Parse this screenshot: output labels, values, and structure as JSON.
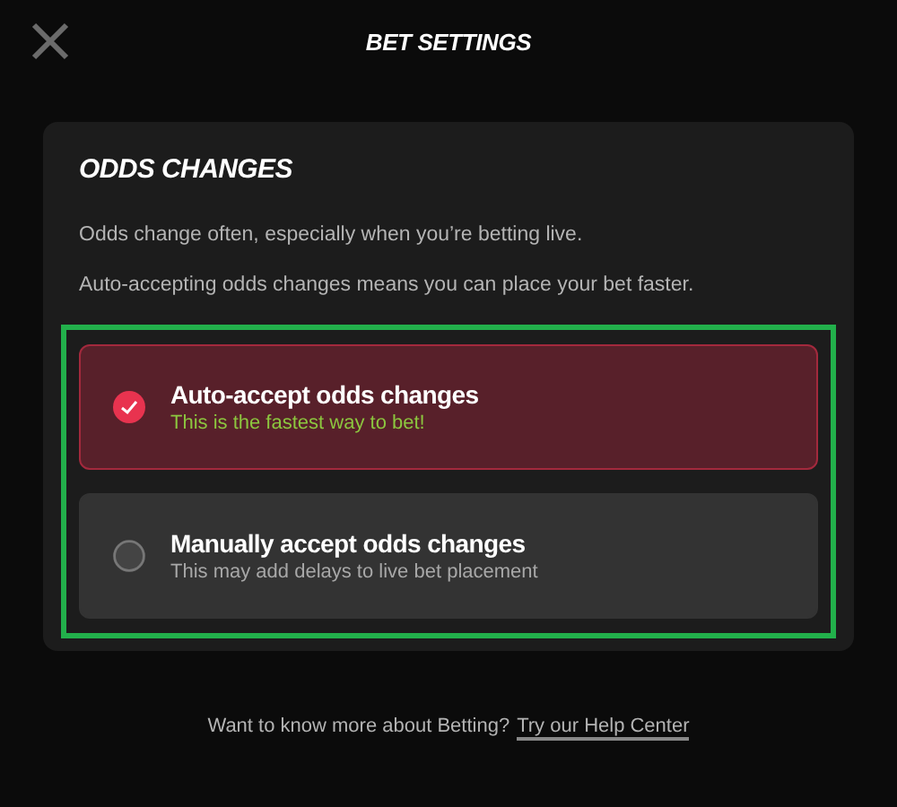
{
  "header": {
    "title": "BET SETTINGS"
  },
  "section": {
    "heading": "ODDS CHANGES",
    "paragraphs": [
      "Odds change often, especially when you’re betting live.",
      "Auto-accepting odds changes means you can place your bet faster."
    ],
    "options_highlighted": true,
    "options": [
      {
        "title": "Auto-accept odds changes",
        "subtitle": "This is the fastest way to bet!",
        "selected": true
      },
      {
        "title": "Manually accept odds changes",
        "subtitle": "This may add delays to live bet placement",
        "selected": false
      }
    ]
  },
  "footer": {
    "text": "Want to know more about Betting?",
    "link": "Try our Help Center"
  }
}
